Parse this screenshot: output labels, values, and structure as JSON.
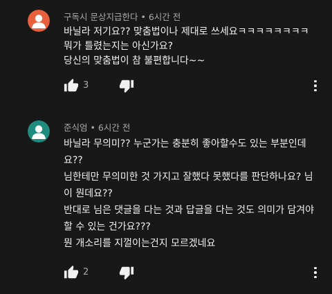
{
  "comments": [
    {
      "author": "구독시 문상지급한다",
      "time": "6시간 전",
      "avatar_color": "#e8603c",
      "lines": [
        "바닐라 저기요?? 맞춤법이나 제대로 쓰세요ㅋㅋㅋㅋㅋㅋㅋㅋ",
        "뭐가 틀렸는지는 아신가요?",
        "당신의 맞춤법이 참 불편합니다~~"
      ],
      "likes": "3"
    },
    {
      "author": "준식엄",
      "time": "6시간 전",
      "avatar_color": "#1e8c7e",
      "lines": [
        "바닐라 무의미?? 누군가는 충분히 좋아할수도 있는 부분인데",
        "요??",
        "님한테만 무의미한 것 가지고 잘했다 못했다를 판단하나요? 님",
        "이 뭔데요??",
        "반대로 님은 댓글을 다는 것과 답글을 다는 것도 의미가 담겨야",
        "할 수 있는 건가요???",
        "뭔 개소리를 지껄이는건지 모르겠네요"
      ],
      "likes": "2"
    }
  ],
  "separator": "•",
  "icons": {
    "like": "thumbs-up-icon",
    "dislike": "thumbs-down-icon",
    "menu": "more-vert-icon",
    "avatar": "person-silhouette-icon"
  }
}
